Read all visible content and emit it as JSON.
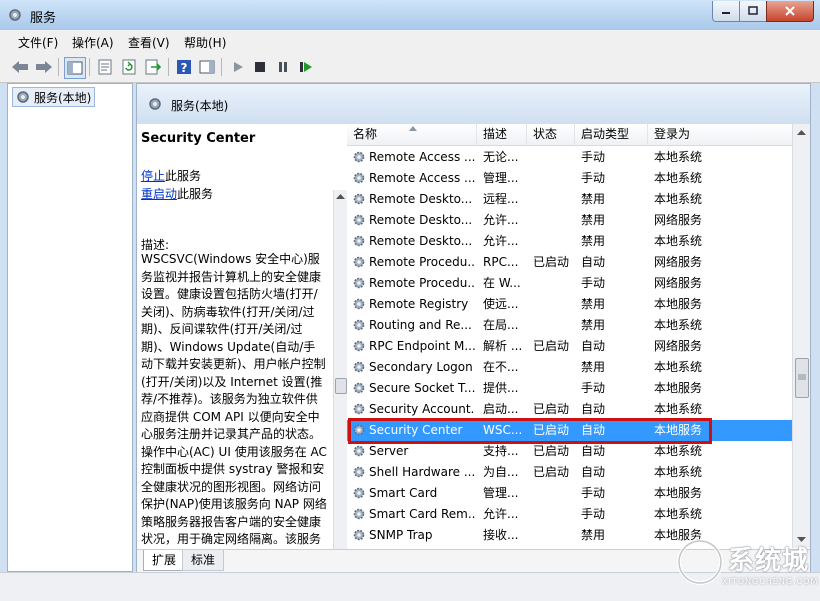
{
  "window": {
    "title": "服务"
  },
  "menu": [
    "文件(F)",
    "操作(A)",
    "查看(V)",
    "帮助(H)"
  ],
  "tree": {
    "item": "服务(本地)"
  },
  "pane": {
    "header": "服务(本地)"
  },
  "description": {
    "service_name": "Security Center",
    "stop_link": "停止",
    "stop_suffix": "此服务",
    "restart_link": "重启动",
    "restart_suffix": "此服务",
    "label": "描述:",
    "text": "WSCSVC(Windows 安全中心)服务监视并报告计算机上的安全健康设置。健康设置包括防火墙(打开/关闭)、防病毒软件(打开/关闭/过期)、反间谍软件(打开/关闭/过期)、Windows Update(自动/手动下载并安装更新)、用户帐户控制(打开/关闭)以及 Internet 设置(推荐/不推荐)。该服务为独立软件供应商提供 COM API 以便向安全中心服务注册并记录其产品的状态。操作中心(AC) UI 使用该服务在 AC 控制面板中提供 systray 警报和安全健康状况的图形视图。网络访问保护(NAP)使用该服务向 NAP 网络策略服务器报告客户端的安全健康状况，用于确定网络隔离。该服务还有一个公用 API，该"
  },
  "columns": [
    "名称",
    "描述",
    "状态",
    "启动类型",
    "登录为"
  ],
  "services": [
    {
      "name": "Remote Access ...",
      "desc": "无论...",
      "status": "",
      "startup": "手动",
      "logon": "本地系统"
    },
    {
      "name": "Remote Access ...",
      "desc": "管理...",
      "status": "",
      "startup": "手动",
      "logon": "本地系统"
    },
    {
      "name": "Remote Deskto...",
      "desc": "远程...",
      "status": "",
      "startup": "禁用",
      "logon": "本地系统"
    },
    {
      "name": "Remote Deskto...",
      "desc": "允许...",
      "status": "",
      "startup": "禁用",
      "logon": "网络服务"
    },
    {
      "name": "Remote Deskto...",
      "desc": "允许...",
      "status": "",
      "startup": "禁用",
      "logon": "本地系统"
    },
    {
      "name": "Remote Procedu...",
      "desc": "RPC...",
      "status": "已启动",
      "startup": "自动",
      "logon": "网络服务"
    },
    {
      "name": "Remote Procedu...",
      "desc": "在 W...",
      "status": "",
      "startup": "手动",
      "logon": "网络服务"
    },
    {
      "name": "Remote Registry",
      "desc": "使远...",
      "status": "",
      "startup": "禁用",
      "logon": "本地服务"
    },
    {
      "name": "Routing and Re...",
      "desc": "在局...",
      "status": "",
      "startup": "禁用",
      "logon": "本地系统"
    },
    {
      "name": "RPC Endpoint M...",
      "desc": "解析 ...",
      "status": "已启动",
      "startup": "自动",
      "logon": "网络服务"
    },
    {
      "name": "Secondary Logon",
      "desc": "在不...",
      "status": "",
      "startup": "禁用",
      "logon": "本地系统"
    },
    {
      "name": "Secure Socket T...",
      "desc": "提供...",
      "status": "",
      "startup": "手动",
      "logon": "本地服务"
    },
    {
      "name": "Security Account...",
      "desc": "启动...",
      "status": "已启动",
      "startup": "自动",
      "logon": "本地系统"
    },
    {
      "name": "Security Center",
      "desc": "WSC...",
      "status": "已启动",
      "startup": "自动",
      "logon": "本地服务",
      "selected": true
    },
    {
      "name": "Server",
      "desc": "支持...",
      "status": "已启动",
      "startup": "自动",
      "logon": "本地系统"
    },
    {
      "name": "Shell Hardware ...",
      "desc": "为自...",
      "status": "已启动",
      "startup": "自动",
      "logon": "本地系统"
    },
    {
      "name": "Smart Card",
      "desc": "管理...",
      "status": "",
      "startup": "手动",
      "logon": "本地服务"
    },
    {
      "name": "Smart Card Rem...",
      "desc": "允许...",
      "status": "",
      "startup": "手动",
      "logon": "本地系统"
    },
    {
      "name": "SNMP Trap",
      "desc": "接收...",
      "status": "",
      "startup": "禁用",
      "logon": "本地服务"
    }
  ],
  "tabs": [
    "扩展",
    "标准"
  ],
  "watermark": {
    "brand": "系统城",
    "url": "XITONGCHENG.COM"
  },
  "colors": {
    "selection": "#3399ff",
    "highlight_border": "#d01010",
    "link": "#0033cc"
  }
}
